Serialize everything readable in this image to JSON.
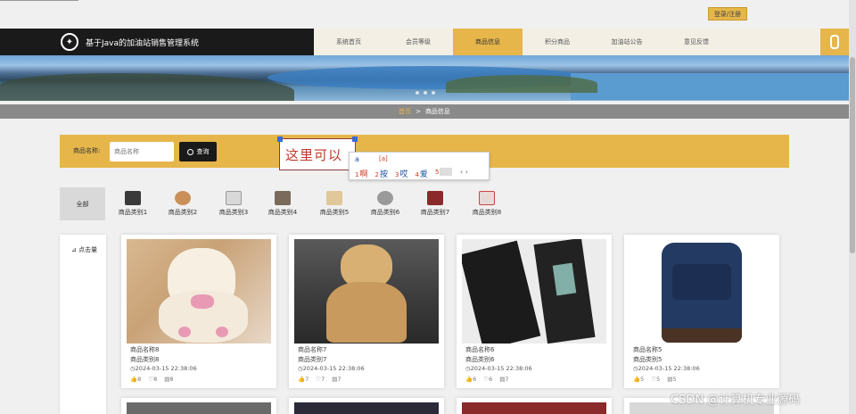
{
  "login_label": "登录/注册",
  "brand": {
    "title": "基于Java的加油站销售管理系统",
    "icon": "lightbulb-icon"
  },
  "nav": [
    {
      "label": "系统首页"
    },
    {
      "label": "会员等级"
    },
    {
      "label": "商品信息",
      "active": true
    },
    {
      "label": "积分商品"
    },
    {
      "label": "加油站公告"
    },
    {
      "label": "意见反馈"
    }
  ],
  "breadcrumb": {
    "home": "首页",
    "sep": ">",
    "current": "商品信息"
  },
  "search": {
    "label": "商品名称:",
    "placeholder": "商品名称",
    "button": "查询"
  },
  "ime": {
    "composition": "这里可以",
    "pinyin": "a",
    "pinyin_bracket": "[a]",
    "candidates": [
      {
        "n": "1",
        "text": "啊"
      },
      {
        "n": "2",
        "text": "按"
      },
      {
        "n": "3",
        "text": "哎"
      },
      {
        "n": "4",
        "text": "爱"
      },
      {
        "n": "5",
        "text": ""
      }
    ],
    "arrows": "‹ ›"
  },
  "categories": {
    "all": "全部",
    "items": [
      "商品类别1",
      "商品类别2",
      "商品类别3",
      "商品类别4",
      "商品类别5",
      "商品类别6",
      "商品类别7",
      "商品类别8"
    ]
  },
  "sort_label": "点击量",
  "products": [
    {
      "name": "商品名称8",
      "category": "商品类别8",
      "time": "2024-03-15 22:38:06",
      "likes": "8",
      "favs": "8",
      "comments": "8"
    },
    {
      "name": "商品名称7",
      "category": "商品类别7",
      "time": "2024-03-15 22:38:06",
      "likes": "7",
      "favs": "7",
      "comments": "7"
    },
    {
      "name": "商品名称6",
      "category": "商品类别6",
      "time": "2024-03-15 22:38:06",
      "likes": "6",
      "favs": "6",
      "comments": "7"
    },
    {
      "name": "商品名称5",
      "category": "商品类别5",
      "time": "2024-03-15 22:38:06",
      "likes": "5",
      "favs": "5",
      "comments": "5"
    }
  ],
  "watermark": "CSDN @计算机专业源码",
  "colors": {
    "accent": "#e6b64a",
    "dark": "#1a1a1a",
    "crumb": "#8a8a8a"
  }
}
